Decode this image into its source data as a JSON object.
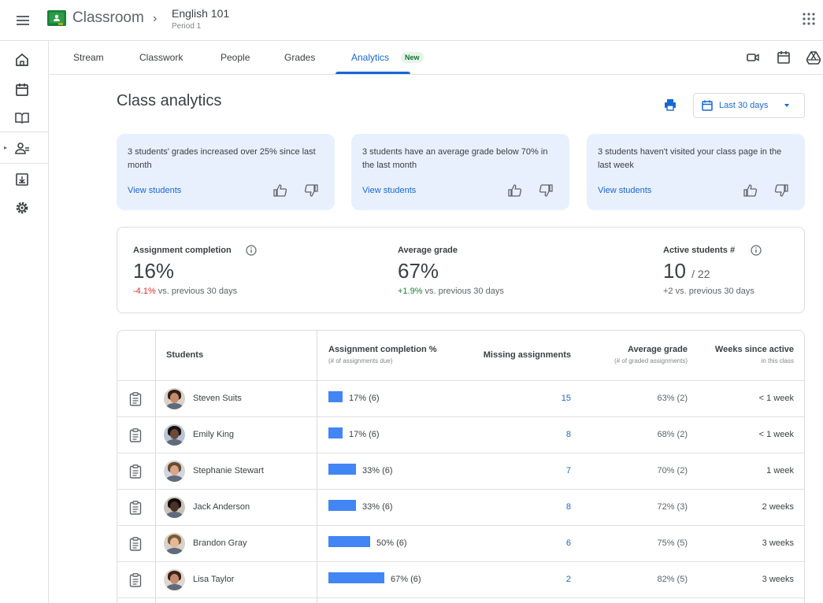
{
  "app": {
    "title": "Classroom",
    "course_name": "English 101",
    "course_section": "Period 1"
  },
  "tabs": [
    {
      "label": "Stream"
    },
    {
      "label": "Classwork"
    },
    {
      "label": "People"
    },
    {
      "label": "Grades"
    },
    {
      "label": "Analytics",
      "badge": "New",
      "active": true
    }
  ],
  "page": {
    "title": "Class analytics",
    "date_range": "Last 30 days"
  },
  "insights": [
    {
      "text": "3 students' grades increased over 25% since last month",
      "link": "View students"
    },
    {
      "text": "3 students have an average grade below 70% in the last month",
      "link": "View students"
    },
    {
      "text": "3 students haven't visited your class page in the last week",
      "link": "View students"
    }
  ],
  "stats": {
    "completion": {
      "label": "Assignment completion",
      "value": "16%",
      "delta": "-4.1%",
      "delta_suffix": " vs. previous 30 days"
    },
    "avg_grade": {
      "label": "Average grade",
      "value": "67%",
      "delta": "+1.9%",
      "delta_suffix": " vs. previous 30 days"
    },
    "active": {
      "label": "Active students #",
      "value": "10",
      "denominator": "/ 22",
      "delta_text": "+2 vs. previous 30 days"
    }
  },
  "table": {
    "headers": {
      "students": "Students",
      "completion": "Assignment completion %",
      "completion_sub": "(# of assignments due)",
      "missing": "Missing assignments",
      "grade": "Average grade",
      "grade_sub": "(# of graded assignments)",
      "weeks": "Weeks since active",
      "weeks_sub": "in this class"
    },
    "rows": [
      {
        "name": "Steven Suits",
        "completion": "17% (6)",
        "completion_pct": 17,
        "missing": "15",
        "grade": "63% (2)",
        "weeks": "< 1 week"
      },
      {
        "name": "Emily King",
        "completion": "17% (6)",
        "completion_pct": 17,
        "missing": "8",
        "grade": "68% (2)",
        "weeks": "< 1 week"
      },
      {
        "name": "Stephanie Stewart",
        "completion": "33% (6)",
        "completion_pct": 33,
        "missing": "7",
        "grade": "70% (2)",
        "weeks": "1 week"
      },
      {
        "name": "Jack Anderson",
        "completion": "33% (6)",
        "completion_pct": 33,
        "missing": "8",
        "grade": "72% (3)",
        "weeks": "2 weeks"
      },
      {
        "name": "Brandon Gray",
        "completion": "50% (6)",
        "completion_pct": 50,
        "missing": "6",
        "grade": "75% (5)",
        "weeks": "3 weeks"
      },
      {
        "name": "Lisa Taylor",
        "completion": "67% (6)",
        "completion_pct": 67,
        "missing": "2",
        "grade": "82% (5)",
        "weeks": "3 weeks"
      }
    ]
  },
  "colors": {
    "accent": "#1967d2",
    "bar": "#4285f4",
    "card_bg": "#e8f0fe",
    "negative": "#d93025",
    "positive": "#188038"
  }
}
